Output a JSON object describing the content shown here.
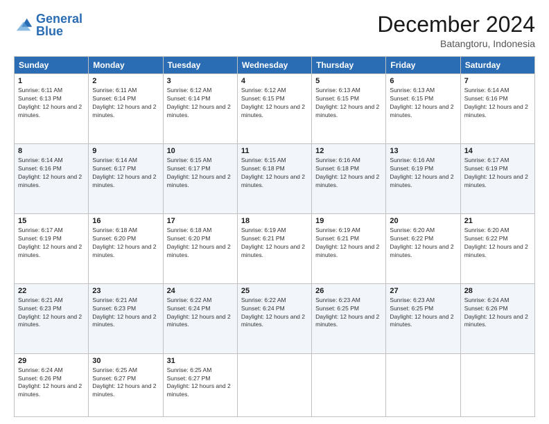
{
  "logo": {
    "line1": "General",
    "line2": "Blue"
  },
  "title": "December 2024",
  "subtitle": "Batangtoru, Indonesia",
  "days_header": [
    "Sunday",
    "Monday",
    "Tuesday",
    "Wednesday",
    "Thursday",
    "Friday",
    "Saturday"
  ],
  "weeks": [
    [
      {
        "day": "1",
        "sunrise": "6:11 AM",
        "sunset": "6:13 PM",
        "daylight": "12 hours and 2 minutes."
      },
      {
        "day": "2",
        "sunrise": "6:11 AM",
        "sunset": "6:14 PM",
        "daylight": "12 hours and 2 minutes."
      },
      {
        "day": "3",
        "sunrise": "6:12 AM",
        "sunset": "6:14 PM",
        "daylight": "12 hours and 2 minutes."
      },
      {
        "day": "4",
        "sunrise": "6:12 AM",
        "sunset": "6:15 PM",
        "daylight": "12 hours and 2 minutes."
      },
      {
        "day": "5",
        "sunrise": "6:13 AM",
        "sunset": "6:15 PM",
        "daylight": "12 hours and 2 minutes."
      },
      {
        "day": "6",
        "sunrise": "6:13 AM",
        "sunset": "6:15 PM",
        "daylight": "12 hours and 2 minutes."
      },
      {
        "day": "7",
        "sunrise": "6:14 AM",
        "sunset": "6:16 PM",
        "daylight": "12 hours and 2 minutes."
      }
    ],
    [
      {
        "day": "8",
        "sunrise": "6:14 AM",
        "sunset": "6:16 PM",
        "daylight": "12 hours and 2 minutes."
      },
      {
        "day": "9",
        "sunrise": "6:14 AM",
        "sunset": "6:17 PM",
        "daylight": "12 hours and 2 minutes."
      },
      {
        "day": "10",
        "sunrise": "6:15 AM",
        "sunset": "6:17 PM",
        "daylight": "12 hours and 2 minutes."
      },
      {
        "day": "11",
        "sunrise": "6:15 AM",
        "sunset": "6:18 PM",
        "daylight": "12 hours and 2 minutes."
      },
      {
        "day": "12",
        "sunrise": "6:16 AM",
        "sunset": "6:18 PM",
        "daylight": "12 hours and 2 minutes."
      },
      {
        "day": "13",
        "sunrise": "6:16 AM",
        "sunset": "6:19 PM",
        "daylight": "12 hours and 2 minutes."
      },
      {
        "day": "14",
        "sunrise": "6:17 AM",
        "sunset": "6:19 PM",
        "daylight": "12 hours and 2 minutes."
      }
    ],
    [
      {
        "day": "15",
        "sunrise": "6:17 AM",
        "sunset": "6:19 PM",
        "daylight": "12 hours and 2 minutes."
      },
      {
        "day": "16",
        "sunrise": "6:18 AM",
        "sunset": "6:20 PM",
        "daylight": "12 hours and 2 minutes."
      },
      {
        "day": "17",
        "sunrise": "6:18 AM",
        "sunset": "6:20 PM",
        "daylight": "12 hours and 2 minutes."
      },
      {
        "day": "18",
        "sunrise": "6:19 AM",
        "sunset": "6:21 PM",
        "daylight": "12 hours and 2 minutes."
      },
      {
        "day": "19",
        "sunrise": "6:19 AM",
        "sunset": "6:21 PM",
        "daylight": "12 hours and 2 minutes."
      },
      {
        "day": "20",
        "sunrise": "6:20 AM",
        "sunset": "6:22 PM",
        "daylight": "12 hours and 2 minutes."
      },
      {
        "day": "21",
        "sunrise": "6:20 AM",
        "sunset": "6:22 PM",
        "daylight": "12 hours and 2 minutes."
      }
    ],
    [
      {
        "day": "22",
        "sunrise": "6:21 AM",
        "sunset": "6:23 PM",
        "daylight": "12 hours and 2 minutes."
      },
      {
        "day": "23",
        "sunrise": "6:21 AM",
        "sunset": "6:23 PM",
        "daylight": "12 hours and 2 minutes."
      },
      {
        "day": "24",
        "sunrise": "6:22 AM",
        "sunset": "6:24 PM",
        "daylight": "12 hours and 2 minutes."
      },
      {
        "day": "25",
        "sunrise": "6:22 AM",
        "sunset": "6:24 PM",
        "daylight": "12 hours and 2 minutes."
      },
      {
        "day": "26",
        "sunrise": "6:23 AM",
        "sunset": "6:25 PM",
        "daylight": "12 hours and 2 minutes."
      },
      {
        "day": "27",
        "sunrise": "6:23 AM",
        "sunset": "6:25 PM",
        "daylight": "12 hours and 2 minutes."
      },
      {
        "day": "28",
        "sunrise": "6:24 AM",
        "sunset": "6:26 PM",
        "daylight": "12 hours and 2 minutes."
      }
    ],
    [
      {
        "day": "29",
        "sunrise": "6:24 AM",
        "sunset": "6:26 PM",
        "daylight": "12 hours and 2 minutes."
      },
      {
        "day": "30",
        "sunrise": "6:25 AM",
        "sunset": "6:27 PM",
        "daylight": "12 hours and 2 minutes."
      },
      {
        "day": "31",
        "sunrise": "6:25 AM",
        "sunset": "6:27 PM",
        "daylight": "12 hours and 2 minutes."
      },
      null,
      null,
      null,
      null
    ]
  ]
}
